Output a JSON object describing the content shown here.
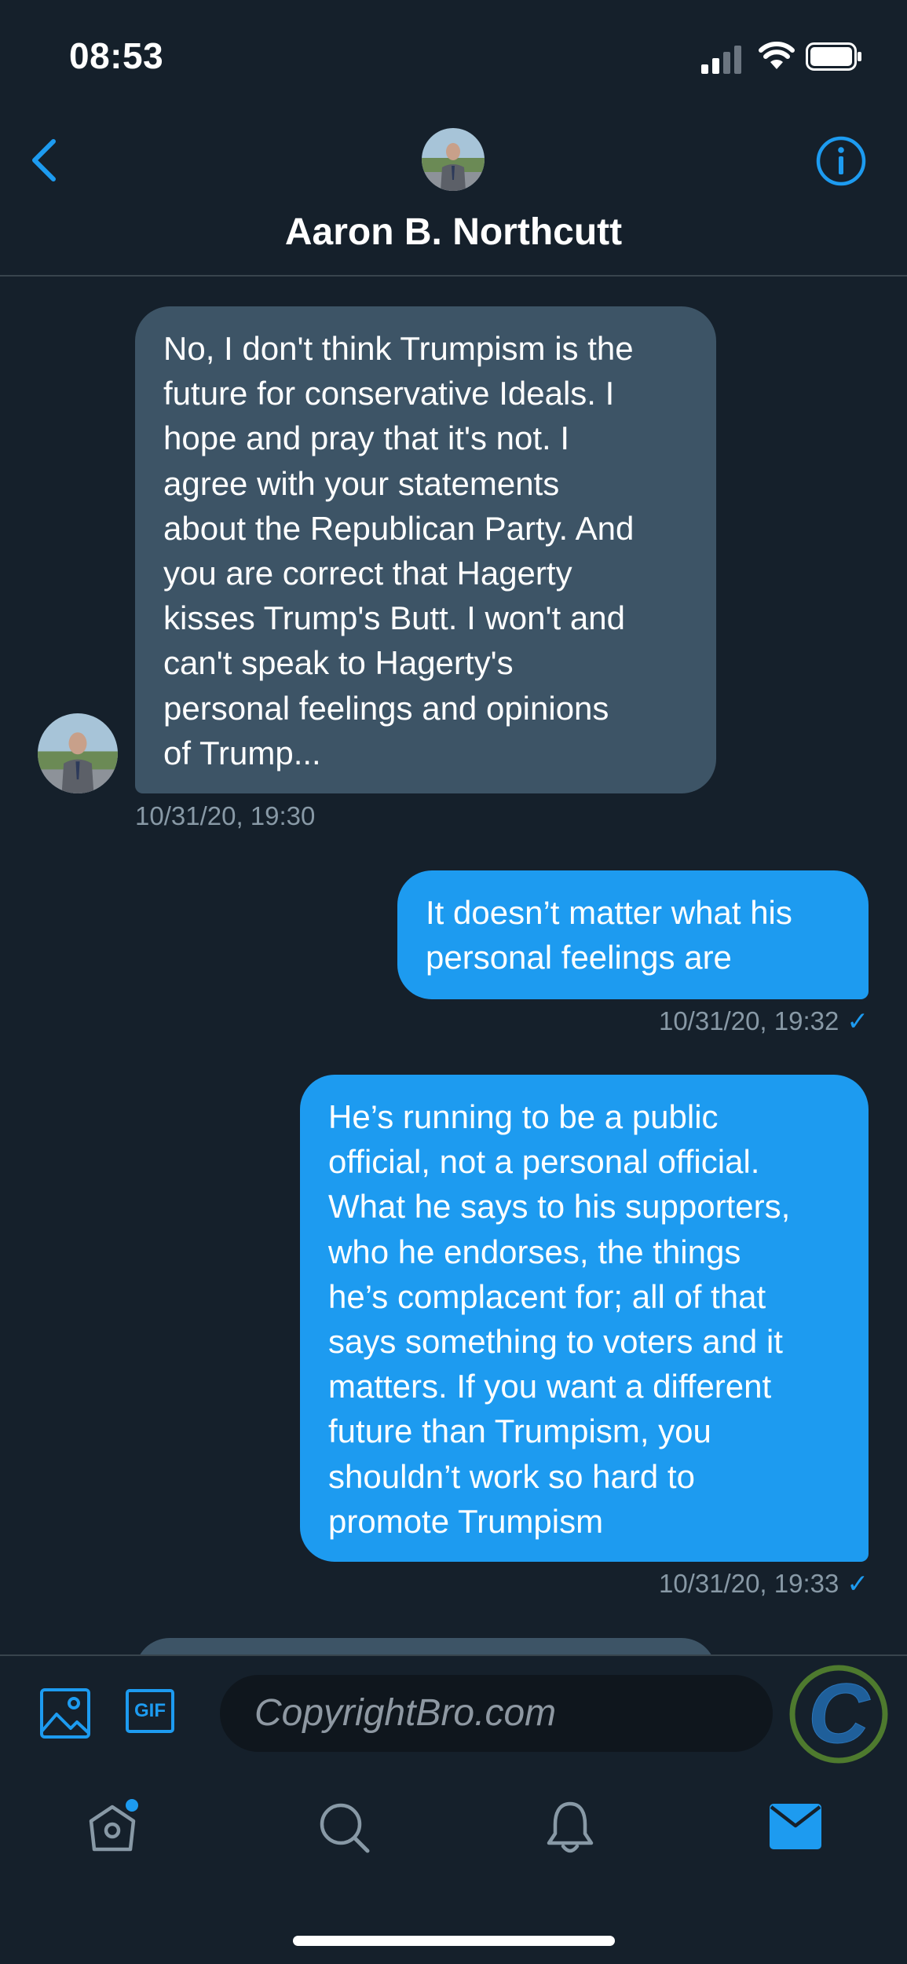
{
  "status_bar": {
    "time": "08:53",
    "icons": [
      "cellular-signal-icon",
      "wifi-icon",
      "battery-icon"
    ]
  },
  "header": {
    "back_icon": "chevron-left-icon",
    "title": "Aaron B. Northcutt",
    "info_icon": "info-icon"
  },
  "messages": [
    {
      "direction": "received",
      "text": "No, I don't think Trumpism is the future for conservative Ideals. I hope and pray that it's not. I agree with your statements about the Republican Party. And you are correct that Hagerty kisses Trump's Butt. I won't and can't speak to Hagerty's personal feelings and opinions of Trump...",
      "lines": [
        "No, I don't think Trumpism is the",
        "future for conservative Ideals. I",
        "hope and pray that it's not. I",
        "agree with your statements",
        "about the Republican Party. And",
        "you are correct that Hagerty",
        "kisses Trump's Butt. I won't and",
        "can't speak to Hagerty's",
        "personal feelings and opinions",
        "of Trump..."
      ],
      "timestamp": "10/31/20, 19:30"
    },
    {
      "direction": "sent",
      "lines": [
        "It doesn’t matter what his",
        "personal feelings are"
      ],
      "timestamp": "10/31/20, 19:32",
      "status_icon": "checkmark-icon"
    },
    {
      "direction": "sent",
      "lines": [
        "He’s running to be a public",
        "official, not a personal official.",
        "What he says to his supporters,",
        "who he endorses, the things",
        "he’s complacent for; all of that",
        "says something to voters and it",
        "matters. If you want a different",
        "future than Trumpism, you",
        "shouldn’t work so hard to",
        "promote Trumpism"
      ],
      "timestamp": "10/31/20, 19:33",
      "status_icon": "checkmark-icon"
    }
  ],
  "composer": {
    "image_icon": "image-icon",
    "gif_label": "GIF",
    "input_text": "CopyrightBro.com",
    "watermark_letter": "C"
  },
  "tab_bar": {
    "items": [
      "home-icon",
      "search-icon",
      "notifications-bell-icon",
      "messages-envelope-icon"
    ],
    "active": "messages-envelope-icon",
    "home_has_badge": true
  },
  "colors": {
    "background": "#15202b",
    "accent": "#1d9bf0",
    "received_bubble": "#3d5466",
    "muted_text": "#8899a6",
    "watermark_ring": "#4e7a2e"
  }
}
